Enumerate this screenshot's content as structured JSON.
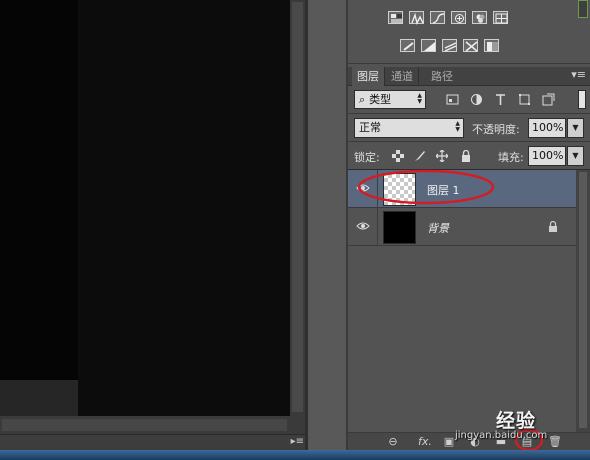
{
  "status_bar": {
    "menu_glyph": "▸≡"
  },
  "adjustments": {
    "row1_icons": [
      "brightness-contrast-icon",
      "levels-icon",
      "curves-icon",
      "exposure-icon",
      "color-balance-icon",
      "vibrance-icon"
    ],
    "row2_icons": [
      "posterize-icon",
      "threshold-icon",
      "gradient-map-icon",
      "selective-color-icon",
      "black-white-icon"
    ]
  },
  "tabs": [
    {
      "label": "图层",
      "active": true
    },
    {
      "label": "通道",
      "active": false
    },
    {
      "label": "路径",
      "active": false
    }
  ],
  "tab_menu_glyph": "▾≡",
  "filter": {
    "search_glyph": "⌕",
    "kind_label": "类型",
    "icons": [
      "pixel-filter-icon",
      "adjustment-filter-icon",
      "type-filter-icon",
      "shape-filter-icon",
      "smart-object-filter-icon"
    ]
  },
  "blend": {
    "mode": "正常",
    "opacity_label": "不透明度:",
    "opacity_value": "100%"
  },
  "lock": {
    "label": "锁定:",
    "fill_label": "填充:",
    "fill_value": "100%"
  },
  "layers": [
    {
      "name": "图层 1",
      "selected": true,
      "thumbnail": "transparent",
      "locked": false
    },
    {
      "name": "背景",
      "selected": false,
      "thumbnail": "black",
      "locked": true
    }
  ],
  "bottom_bar": {
    "link_glyph": "⊖",
    "fx_label": "fx.",
    "mask_glyph": "▣",
    "adjust_glyph": "◐",
    "group_glyph": "▬",
    "new_layer_glyph": "▤",
    "trash_glyph": "🗑"
  },
  "watermark": {
    "title": "经验",
    "url": "jingyan.baidu.com"
  },
  "colors": {
    "selected_row": "#59687e",
    "annotation": "#d41c24"
  }
}
